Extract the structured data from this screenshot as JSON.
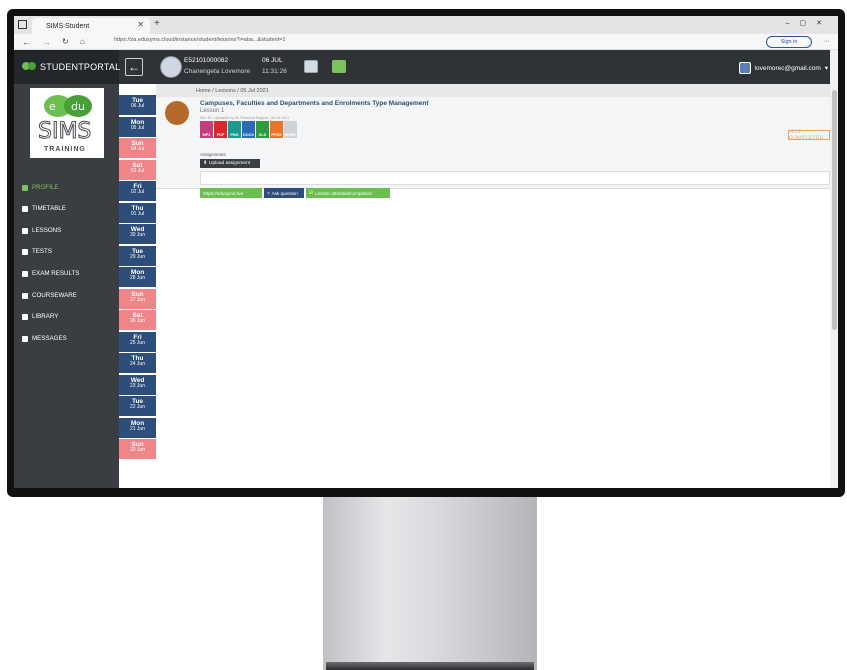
{
  "browser": {
    "tab_title": "SIMS Student",
    "url": "https://za.edusyms.cloud/instance/student/lessons?i=aba...&student=1",
    "signin_label": "Sign in"
  },
  "header": {
    "portal_name": "STUDENTPORTAL",
    "user_code": "E52101000082",
    "user_name": "Chanengeta Lovemore",
    "date": "06 JUL",
    "time": "11:31:26",
    "email": "lovemorec@gmail.com"
  },
  "sidebar": {
    "logo_text": "TRAINING",
    "items": [
      {
        "label": "PROFILE"
      },
      {
        "label": "TIMETABLE"
      },
      {
        "label": "LESSONS"
      },
      {
        "label": "TESTS"
      },
      {
        "label": "EXAM RESULTS"
      },
      {
        "label": "COURSEWARE"
      },
      {
        "label": "LIBRARY"
      },
      {
        "label": "MESSAGES"
      }
    ]
  },
  "dates": [
    {
      "day": "Tue",
      "date": "06 Jul",
      "kind": "weekday"
    },
    {
      "day": "Mon",
      "date": "05 Jul",
      "kind": "selected"
    },
    {
      "day": "Sun",
      "date": "04 Jul",
      "kind": "weekend"
    },
    {
      "day": "Sat",
      "date": "03 Jul",
      "kind": "weekend"
    },
    {
      "day": "Fri",
      "date": "02 Jul",
      "kind": "weekday"
    },
    {
      "day": "Thu",
      "date": "01 Jul",
      "kind": "weekday"
    },
    {
      "day": "Wed",
      "date": "30 Jun",
      "kind": "weekday"
    },
    {
      "day": "Tue",
      "date": "29 Jun",
      "kind": "weekday"
    },
    {
      "day": "Mon",
      "date": "28 Jun",
      "kind": "weekday"
    },
    {
      "day": "Sun",
      "date": "27 Jun",
      "kind": "weekend"
    },
    {
      "day": "Sat",
      "date": "26 Jun",
      "kind": "weekend"
    },
    {
      "day": "Fri",
      "date": "25 Jun",
      "kind": "weekday"
    },
    {
      "day": "Thu",
      "date": "24 Jun",
      "kind": "weekday"
    },
    {
      "day": "Wed",
      "date": "23 Jun",
      "kind": "weekday"
    },
    {
      "day": "Tue",
      "date": "22 Jun",
      "kind": "weekday"
    },
    {
      "day": "Mon",
      "date": "21 Jun",
      "kind": "weekday"
    },
    {
      "day": "Sun",
      "date": "20 Jun",
      "kind": "weekend"
    }
  ],
  "breadcrumb": "Home / Lessons / 05 Jul 2021",
  "lesson": {
    "title": "Campuses, Faculties and Departments and Enrolments Type Management",
    "subtitle": "Lesson 1",
    "ref": "Ref: 40 - Uploaded by Mr Technical Support - 05 Jul 2021",
    "status": "NOT COMPLETED",
    "assignments_label": "Assignments",
    "upload_label": "Upload assignment",
    "files": [
      {
        "type": "MP4",
        "color": "#c73e7a"
      },
      {
        "type": "PDF",
        "color": "#d9282f"
      },
      {
        "type": "PNG",
        "color": "#1a9b8f"
      },
      {
        "type": "DOCX",
        "color": "#2a6ab8"
      },
      {
        "type": "XLS",
        "color": "#2f9a3f"
      },
      {
        "type": "PPSX",
        "color": "#e8752a"
      },
      {
        "type": "WEBP",
        "color": "#cfd3d8"
      }
    ],
    "buttons": {
      "link": "https://edusyms.live",
      "ask": "Ask question",
      "attended": "Lesson attended/completed"
    }
  },
  "colors": {
    "sidebar_bg": "#3a3d41",
    "accent_green": "#6bbf4e",
    "date_blue": "#2d4d7a",
    "date_red": "#ef8589"
  }
}
